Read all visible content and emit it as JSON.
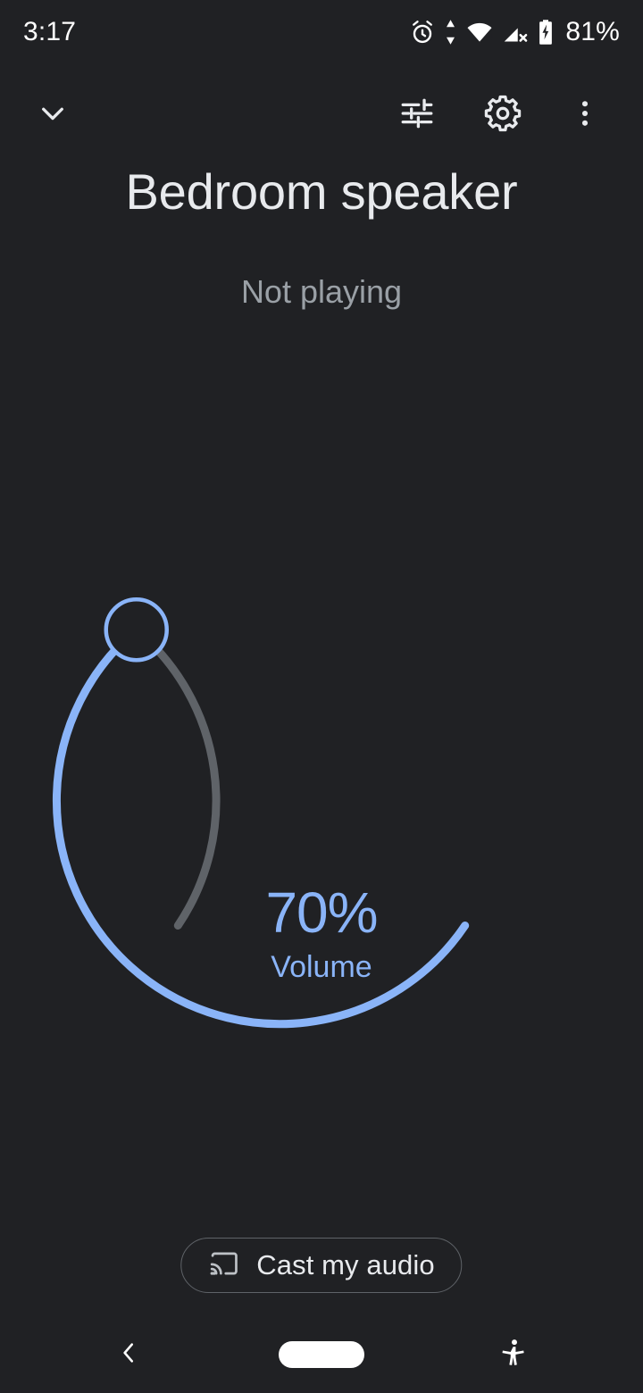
{
  "theme": {
    "background": "#202124",
    "accent": "#8ab4f8",
    "track": "#5f6368",
    "primary_text": "#e8eaed",
    "secondary_text": "#9aa0a6"
  },
  "status_bar": {
    "time": "3:17",
    "battery_percent": "81%",
    "icons": [
      {
        "name": "alarm-icon"
      },
      {
        "name": "data-transfer-icon"
      },
      {
        "name": "wifi-icon",
        "badge": "4"
      },
      {
        "name": "no-sim-signal-icon"
      },
      {
        "name": "battery-charging-icon"
      }
    ]
  },
  "top_bar": {
    "collapse_label": "collapse",
    "tune_label": "equalizer",
    "settings_label": "settings",
    "overflow_label": "more options"
  },
  "device": {
    "title": "Bedroom speaker",
    "playback_status": "Not playing"
  },
  "volume": {
    "value": 70,
    "value_label": "70%",
    "caption": "Volume",
    "min": 0,
    "max": 100
  },
  "cast": {
    "label": "Cast my audio",
    "icon": "cast-icon"
  },
  "nav_bar": {
    "back_label": "Back",
    "home_label": "Home",
    "accessibility_label": "Accessibility"
  }
}
